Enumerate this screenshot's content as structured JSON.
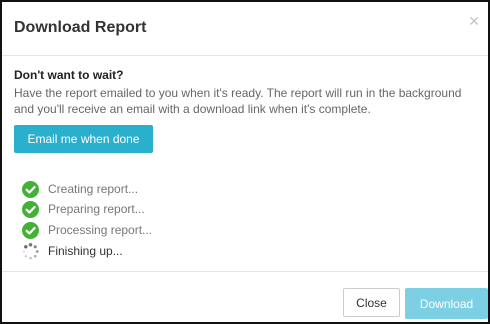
{
  "modal": {
    "title": "Download Report",
    "close_icon": "close-icon",
    "subtitle": "Don't want to wait?",
    "description": "Have the report emailed to you when it's ready. The report will run in the background and you'll receive an email with a download link when it's complete.",
    "email_button_label": "Email me when done"
  },
  "steps": [
    {
      "label": "Creating report...",
      "status": "complete",
      "icon": "check-circle-icon"
    },
    {
      "label": "Preparing report...",
      "status": "complete",
      "icon": "check-circle-icon"
    },
    {
      "label": "Processing report...",
      "status": "complete",
      "icon": "check-circle-icon"
    },
    {
      "label": "Finishing up...",
      "status": "in-progress",
      "icon": "spinner-icon"
    }
  ],
  "footer": {
    "close_label": "Close",
    "download_label": "Download"
  },
  "colors": {
    "accent": "#2ab0cd",
    "accent_disabled": "#7dd0e3",
    "success": "#44b035"
  }
}
